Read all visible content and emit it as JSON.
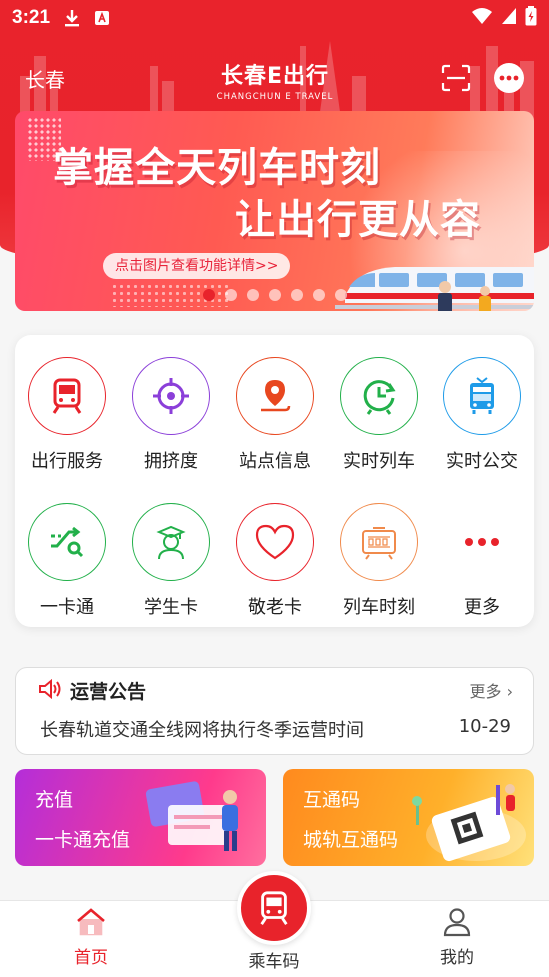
{
  "status_bar": {
    "time": "3:21"
  },
  "header": {
    "city": "长春",
    "logo_cn": "长春E出行",
    "logo_en": "CHANGCHUN E TRAVEL"
  },
  "banner": {
    "line1": "掌握全天列车时刻",
    "line2": "让出行更从容",
    "pill": "点击图片查看功能详情>>",
    "indicator_count": 7,
    "active_index": 0
  },
  "services": [
    {
      "label": "出行服务",
      "icon": "train-icon",
      "color": "#e8232b"
    },
    {
      "label": "拥挤度",
      "icon": "target-icon",
      "color": "#8b3fd9"
    },
    {
      "label": "站点信息",
      "icon": "location-icon",
      "color": "#e8471f"
    },
    {
      "label": "实时列车",
      "icon": "clock-icon",
      "color": "#22b04a"
    },
    {
      "label": "实时公交",
      "icon": "bus-icon",
      "color": "#1e9be8"
    },
    {
      "label": "一卡通",
      "icon": "card-route-icon",
      "color": "#22b04a"
    },
    {
      "label": "学生卡",
      "icon": "student-icon",
      "color": "#22b04a"
    },
    {
      "label": "敬老卡",
      "icon": "heart-icon",
      "color": "#e8232b"
    },
    {
      "label": "列车时刻",
      "icon": "timetable-icon",
      "color": "#f08a4b"
    },
    {
      "label": "更多",
      "icon": "more-dots-icon",
      "color": "#e8232b"
    }
  ],
  "notice": {
    "title": "运营公告",
    "more": "更多",
    "item_text": "长春轨道交通全线网将执行冬季运营时间",
    "item_date": "10-29"
  },
  "promos": [
    {
      "title": "充值",
      "subtitle": "一卡通充值"
    },
    {
      "title": "互通码",
      "subtitle": "城轨互通码"
    }
  ],
  "tabbar": {
    "home": "首页",
    "ride_code": "乘车码",
    "mine": "我的",
    "active_color": "#e8232b"
  }
}
